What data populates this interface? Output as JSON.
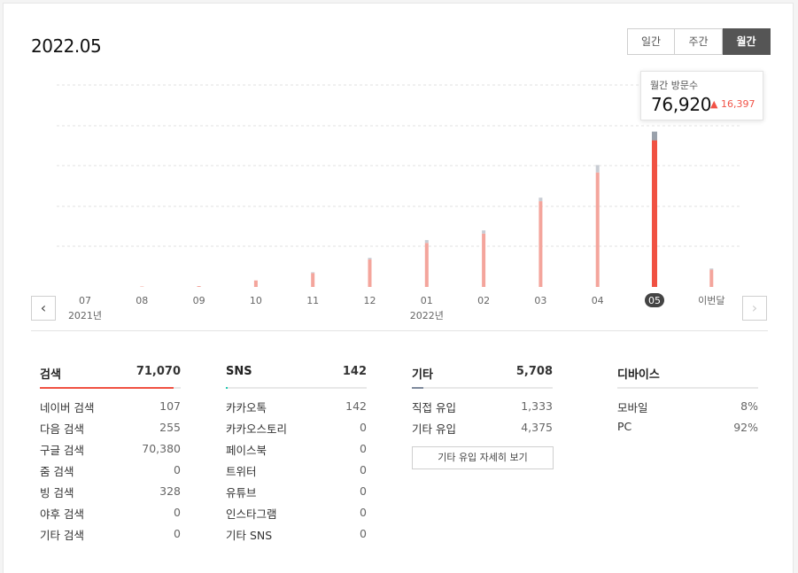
{
  "header": {
    "title": "2022.05"
  },
  "period_tabs": [
    "일간",
    "주간",
    "월간"
  ],
  "selected_period": "월간",
  "chart_data": {
    "type": "bar",
    "stacked": true,
    "categories": [
      "07",
      "08",
      "09",
      "10",
      "11",
      "12",
      "01",
      "02",
      "03",
      "04",
      "05",
      "이번달"
    ],
    "year_labels": [
      {
        "at": "07",
        "label": "2021년"
      },
      {
        "at": "01",
        "label": "2022년"
      }
    ],
    "selected_category": "05",
    "series": [
      {
        "values": [
          0,
          300,
          600,
          4500,
          9600,
          19200,
          30500,
          37000,
          59500,
          79400,
          101600,
          12000
        ]
      },
      {
        "values": [
          0,
          0,
          0,
          0,
          600,
          1000,
          2000,
          2200,
          2400,
          5100,
          6100,
          800
        ]
      }
    ],
    "ylim": [
      0,
      140000
    ],
    "grid": true,
    "colors": {
      "bar": "#f4a59c",
      "bar_selected": "#f05142",
      "cap": "#c8ccd3",
      "cap_selected": "#9aa1ab"
    }
  },
  "tooltip": {
    "label": "월간 방문수",
    "value": "76,920",
    "delta": "▲ 16,397"
  },
  "nav": {
    "prev_label": "‹",
    "next_label": "›"
  },
  "breakdown": {
    "search": {
      "name": "검색",
      "total": "71,070",
      "color": "#f05142",
      "progress": 0.95,
      "rows": [
        {
          "k": "네이버 검색",
          "v": "107"
        },
        {
          "k": "다음 검색",
          "v": "255"
        },
        {
          "k": "구글 검색",
          "v": "70,380"
        },
        {
          "k": "줌 검색",
          "v": "0"
        },
        {
          "k": "빙 검색",
          "v": "328"
        },
        {
          "k": "야후 검색",
          "v": "0"
        },
        {
          "k": "기타 검색",
          "v": "0"
        }
      ]
    },
    "sns": {
      "name": "SNS",
      "total": "142",
      "color": "#1ec8b0",
      "progress": 0.01,
      "rows": [
        {
          "k": "카카오톡",
          "v": "142"
        },
        {
          "k": "카카오스토리",
          "v": "0"
        },
        {
          "k": "페이스북",
          "v": "0"
        },
        {
          "k": "트위터",
          "v": "0"
        },
        {
          "k": "유튜브",
          "v": "0"
        },
        {
          "k": "인스타그램",
          "v": "0"
        },
        {
          "k": "기타 SNS",
          "v": "0"
        }
      ]
    },
    "other": {
      "name": "기타",
      "total": "5,708",
      "color": "#7e8a9c",
      "progress": 0.08,
      "rows": [
        {
          "k": "직접 유입",
          "v": "1,333"
        },
        {
          "k": "기타 유입",
          "v": "4,375"
        }
      ],
      "button": "기타 유입 자세히 보기"
    },
    "device": {
      "name": "디바이스",
      "rows": [
        {
          "k": "모바일",
          "v": "8%"
        },
        {
          "k": "PC",
          "v": "92%"
        }
      ]
    }
  }
}
